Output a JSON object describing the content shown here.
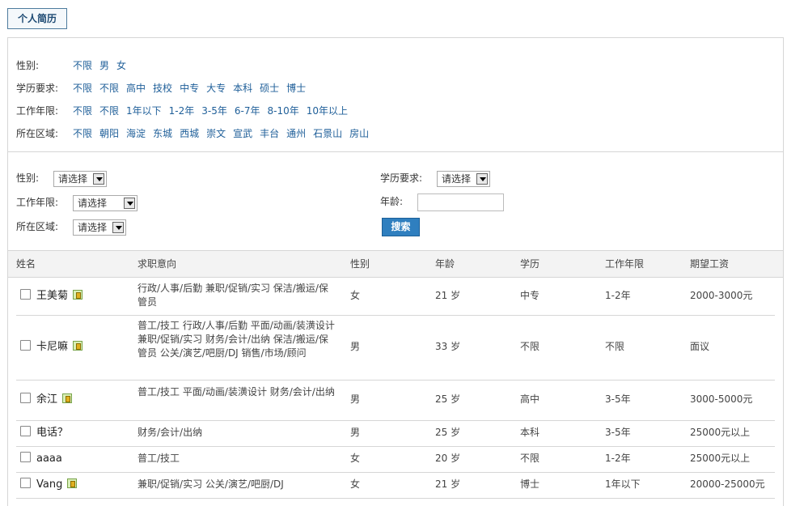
{
  "tab": {
    "label": "个人简历"
  },
  "filters": [
    {
      "label": "性别:",
      "options": [
        "不限",
        "男",
        "女"
      ]
    },
    {
      "label": "学历要求:",
      "options": [
        "不限",
        "不限",
        "高中",
        "技校",
        "中专",
        "大专",
        "本科",
        "硕士",
        "博士"
      ]
    },
    {
      "label": "工作年限:",
      "options": [
        "不限",
        "不限",
        "1年以下",
        "1-2年",
        "3-5年",
        "6-7年",
        "8-10年",
        "10年以上"
      ]
    },
    {
      "label": "所在区域:",
      "options": [
        "不限",
        "朝阳",
        "海淀",
        "东城",
        "西城",
        "崇文",
        "宣武",
        "丰台",
        "通州",
        "石景山",
        "房山"
      ]
    }
  ],
  "search": {
    "gender_label": "性别:",
    "gender_value": "请选择",
    "work_years_label": "工作年限:",
    "work_years_value": "请选择",
    "area_label": "所在区域:",
    "area_value": "请选择",
    "education_label": "学历要求:",
    "education_value": "请选择",
    "age_label": "年龄:",
    "age_value": "",
    "search_button": "搜索"
  },
  "table": {
    "headers": [
      "姓名",
      "求职意向",
      "性别",
      "年龄",
      "学历",
      "工作年限",
      "期望工资"
    ],
    "rows": [
      {
        "name": "王美菊",
        "has_icon": true,
        "intention": "行政/人事/后勤 兼职/促销/实习 保洁/搬运/保管员",
        "gender": "女",
        "age": "21 岁",
        "education": "中专",
        "work_years": "1-2年",
        "salary": "2000-3000元"
      },
      {
        "name": "卡尼嘛",
        "has_icon": true,
        "intention": "普工/技工 行政/人事/后勤 平面/动画/装潢设计 兼职/促销/实习 财务/会计/出纳 保洁/搬运/保管员 公关/演艺/吧厨/DJ 销售/市场/顾问",
        "gender": "男",
        "age": "33 岁",
        "education": "不限",
        "work_years": "不限",
        "salary": "面议"
      },
      {
        "name": "余江",
        "has_icon": true,
        "intention": "普工/技工 平面/动画/装潢设计 财务/会计/出纳",
        "gender": "男",
        "age": "25 岁",
        "education": "高中",
        "work_years": "3-5年",
        "salary": "3000-5000元"
      },
      {
        "name": "电话？",
        "has_icon": false,
        "intention": "财务/会计/出纳",
        "gender": "男",
        "age": "25 岁",
        "education": "本科",
        "work_years": "3-5年",
        "salary": "25000元以上"
      },
      {
        "name": "aaaa",
        "has_icon": false,
        "intention": "普工/技工",
        "gender": "女",
        "age": "20 岁",
        "education": "不限",
        "work_years": "1-2年",
        "salary": "25000元以上"
      },
      {
        "name": "Vang",
        "has_icon": true,
        "intention": "兼职/促销/实习 公关/演艺/吧厨/DJ",
        "gender": "女",
        "age": "21 岁",
        "education": "博士",
        "work_years": "1年以下",
        "salary": "20000-25000元"
      }
    ]
  }
}
